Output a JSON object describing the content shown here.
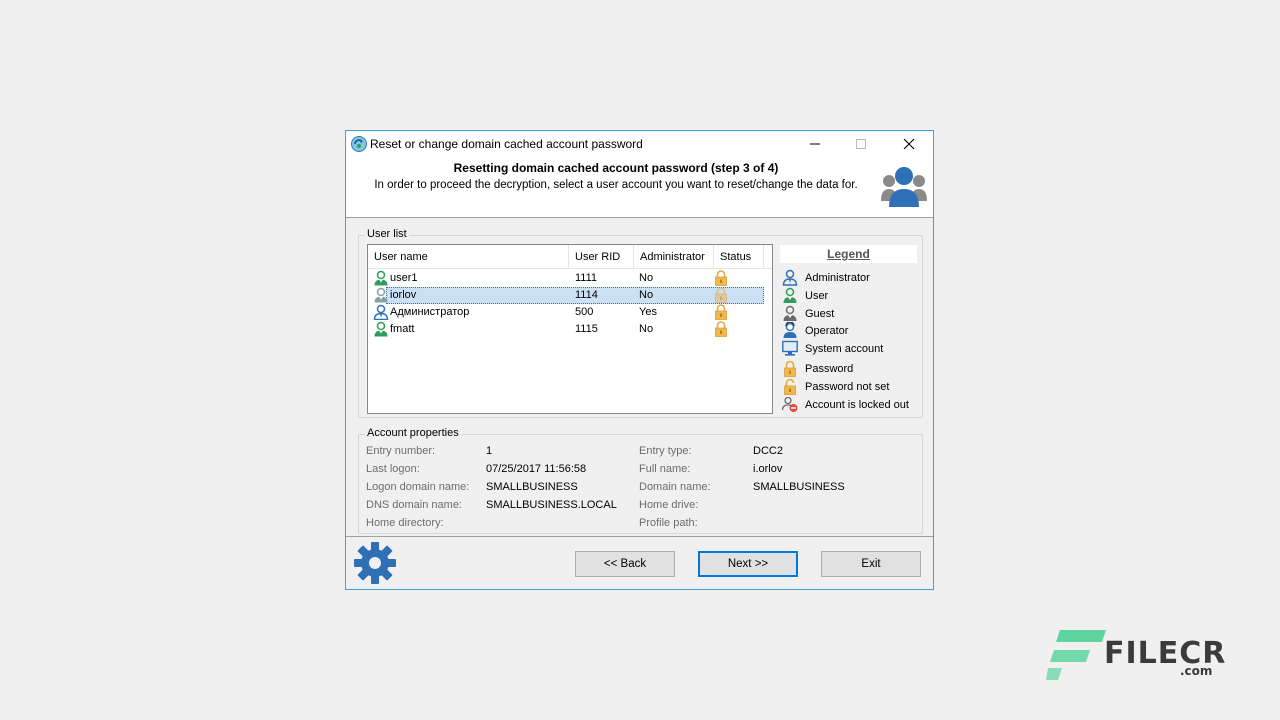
{
  "window": {
    "title": "Reset or change domain cached account password",
    "header_title": "Resetting domain cached account password (step 3 of 4)",
    "header_desc": "In order to proceed the decryption, select a user account you want to reset/change the data for."
  },
  "user_list": {
    "group_label": "User list",
    "columns": [
      "User name",
      "User RID",
      "Administrator",
      "Status"
    ],
    "rows": [
      {
        "name": "user1",
        "rid": "1111",
        "admin": "No",
        "type": "user-icon"
      },
      {
        "name": "iorlov",
        "rid": "1114",
        "admin": "No",
        "type": "guest-icon",
        "selected": true
      },
      {
        "name": "Администратор",
        "rid": "500",
        "admin": "Yes",
        "type": "administrator-icon"
      },
      {
        "name": "fmatt",
        "rid": "1115",
        "admin": "No",
        "type": "user-icon"
      }
    ]
  },
  "legend": {
    "title": "Legend",
    "items": [
      {
        "label": "Administrator",
        "icon": "administrator-icon"
      },
      {
        "label": "User",
        "icon": "user-icon"
      },
      {
        "label": "Guest",
        "icon": "guest-icon"
      },
      {
        "label": "Operator",
        "icon": "operator-icon"
      },
      {
        "label": "System account",
        "icon": "system-account-icon"
      },
      {
        "label": "Password",
        "icon": "lock-icon"
      },
      {
        "label": "Password not set",
        "icon": "unlock-icon"
      },
      {
        "label": "Account is locked out",
        "icon": "locked-out-icon"
      }
    ]
  },
  "account_properties": {
    "group_label": "Account properties",
    "entry_number_label": "Entry number:",
    "entry_number": "1",
    "last_logon_label": "Last logon:",
    "last_logon": "07/25/2017 11:56:58",
    "logon_domain_label": "Logon domain name:",
    "logon_domain": "SMALLBUSINESS",
    "dns_domain_label": "DNS domain name:",
    "dns_domain": "SMALLBUSINESS.LOCAL",
    "home_dir_label": "Home directory:",
    "home_dir": "",
    "entry_type_label": "Entry type:",
    "entry_type": "DCC2",
    "full_name_label": "Full name:",
    "full_name": "i.orlov",
    "domain_name_label": "Domain name:",
    "domain_name": "SMALLBUSINESS",
    "home_drive_label": "Home drive:",
    "home_drive": "",
    "profile_path_label": "Profile path:",
    "profile_path": ""
  },
  "buttons": {
    "back": "<< Back",
    "next": "Next >>",
    "exit": "Exit"
  },
  "watermark": {
    "brand": "FILECR",
    "tld": ".com"
  },
  "colors": {
    "accent": "#3aa3d8",
    "selection": "#cce0f4",
    "icon_blue": "#2e6fb5",
    "icon_green": "#2f9e5a",
    "lock_gold": "#e8a93a",
    "watermark_green": "#5dd39e"
  }
}
